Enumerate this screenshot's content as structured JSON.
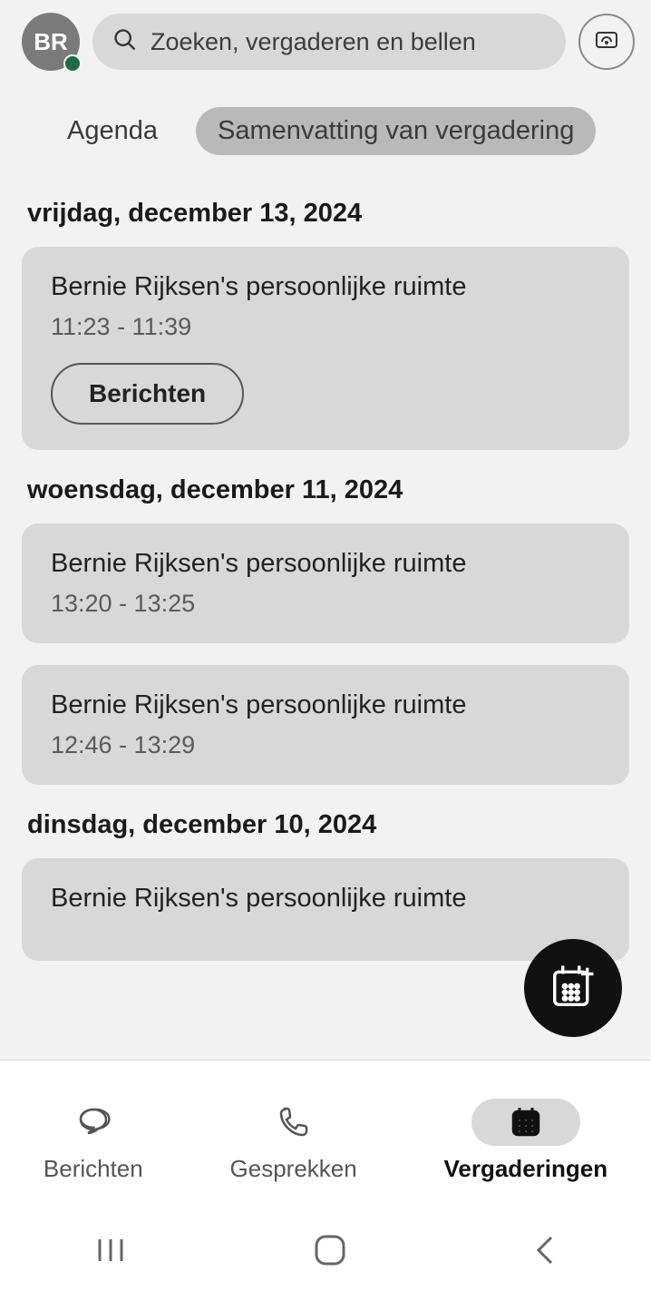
{
  "header": {
    "avatar_initials": "BR",
    "search_placeholder": "Zoeken, vergaderen en bellen"
  },
  "tabs": {
    "agenda": "Agenda",
    "summary": "Samenvatting van vergadering"
  },
  "days": [
    {
      "label": "vrijdag, december 13, 2024",
      "items": [
        {
          "title": "Bernie Rijksen's persoonlijke ruimte",
          "time": "11:23 - 11:39",
          "button": "Berichten"
        }
      ]
    },
    {
      "label": "woensdag, december 11, 2024",
      "items": [
        {
          "title": "Bernie Rijksen's persoonlijke ruimte",
          "time": "13:20 - 13:25"
        },
        {
          "title": "Bernie Rijksen's persoonlijke ruimte",
          "time": "12:46 - 13:29"
        }
      ]
    },
    {
      "label": "dinsdag, december 10, 2024",
      "items": [
        {
          "title": "Bernie Rijksen's persoonlijke ruimte",
          "time": ""
        }
      ]
    }
  ],
  "nav": {
    "messages": "Berichten",
    "calls": "Gesprekken",
    "meetings": "Vergaderingen"
  }
}
